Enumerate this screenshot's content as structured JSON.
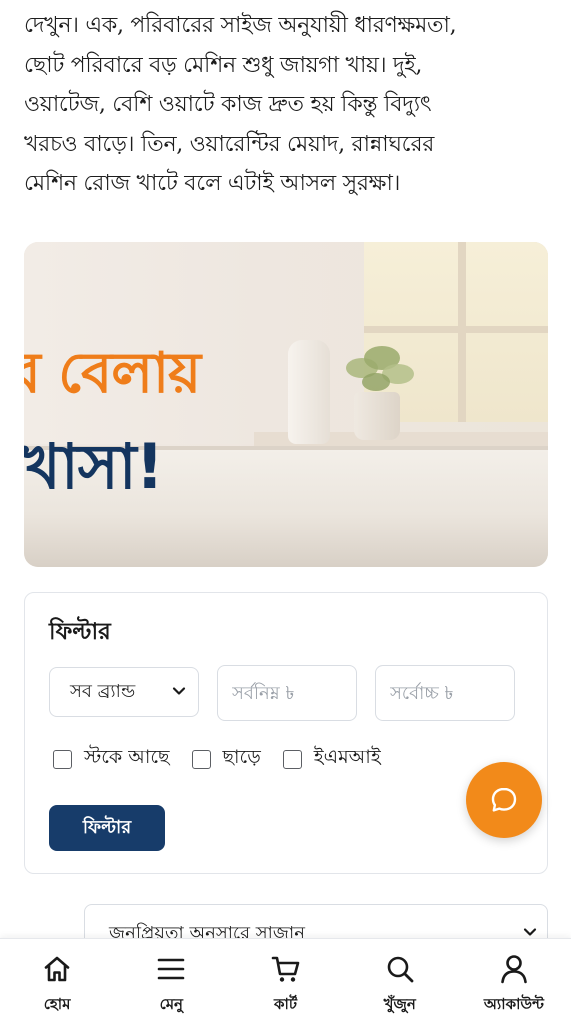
{
  "article": {
    "lines": [
      "দেখুন। এক, পরিবারের সাইজ অনুযায়ী ধারণক্ষমতা,",
      "ছোট পরিবারে বড় মেশিন শুধু জায়গা খায়। দুই,",
      "ওয়াটেজ, বেশি ওয়াটে কাজ দ্রুত হয় কিন্তু বিদ্যুৎ",
      "খরচও বাড়ে। তিন, ওয়ারেন্টির মেয়াদ, রান্নাঘরের",
      "মেশিন রোজ খাটে বলে এটাই আসল সুরক্ষা।"
    ]
  },
  "banner": {
    "headline_line1": "র বেলায়",
    "headline_line2": "খাসা!",
    "colors": {
      "orange": "#ef7d1a",
      "navy": "#14355f"
    }
  },
  "filter": {
    "title": "ফিল্টার",
    "brand_select_value": "সব ব্র্যান্ড",
    "min_price_placeholder": "সর্বনিম্ন ৳",
    "max_price_placeholder": "সর্বোচ্চ ৳",
    "checkboxes": [
      {
        "label": "স্টকে আছে",
        "checked": false
      },
      {
        "label": "ছাড়ে",
        "checked": false
      },
      {
        "label": "ইএমআই",
        "checked": false
      }
    ],
    "submit_label": "ফিল্টার"
  },
  "chat": {
    "icon": "chat-bubble-icon",
    "color": "#f28a1a"
  },
  "sort": {
    "value": "জনপ্রিয়তা অনুসারে সাজান"
  },
  "bottom_nav": {
    "items": [
      {
        "label": "হোম",
        "icon": "home-icon"
      },
      {
        "label": "মেনু",
        "icon": "menu-icon"
      },
      {
        "label": "কার্ট",
        "icon": "cart-icon"
      },
      {
        "label": "খুঁজুন",
        "icon": "search-icon"
      },
      {
        "label": "অ্যাকাউন্ট",
        "icon": "user-icon"
      }
    ]
  }
}
